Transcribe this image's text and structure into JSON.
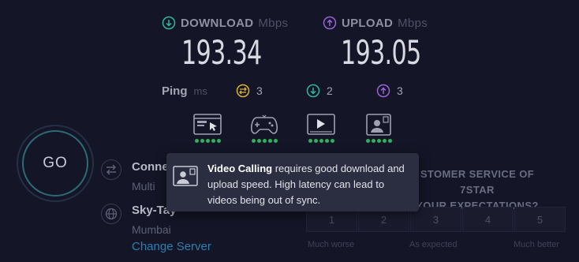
{
  "download": {
    "label": "DOWNLOAD",
    "unit": "Mbps",
    "value": "193.34",
    "icon": "download-arrow-icon",
    "color": "#2fb99a"
  },
  "upload": {
    "label": "UPLOAD",
    "unit": "Mbps",
    "value": "193.05",
    "icon": "upload-arrow-icon",
    "color": "#9b63d9"
  },
  "ping": {
    "label": "Ping",
    "unit": "ms",
    "idle": "3",
    "download": "2",
    "upload": "3"
  },
  "activities": [
    {
      "name": "web-browsing",
      "icon": "web-browsing-icon",
      "rating": 5
    },
    {
      "name": "gaming",
      "icon": "gamepad-icon",
      "rating": 5
    },
    {
      "name": "video-streaming",
      "icon": "video-player-icon",
      "rating": 5
    },
    {
      "name": "video-calling",
      "icon": "video-call-icon",
      "rating": 5
    }
  ],
  "go_label": "GO",
  "connection": {
    "title": "Conne",
    "subtitle": "Multi"
  },
  "server": {
    "title": "Sky-Tay",
    "location": "Mumbai",
    "change_label": "Change Server"
  },
  "survey": {
    "question_line1": "STOMER SERVICE OF 7STAR",
    "question_line2": "YOUR EXPECTATIONS?",
    "options": [
      "1",
      "2",
      "3",
      "4",
      "5"
    ],
    "low_label": "Much worse",
    "mid_label": "As expected",
    "high_label": "Much better"
  },
  "tooltip": {
    "title": "Video Calling",
    "body_line1": " requires good download and",
    "body_line2": "upload speed. High latency can lead to",
    "body_line3": "videos being out of sync."
  },
  "colors": {
    "background": "#141526",
    "rating_dot": "#2fb15b",
    "link": "#2e7fb2"
  }
}
